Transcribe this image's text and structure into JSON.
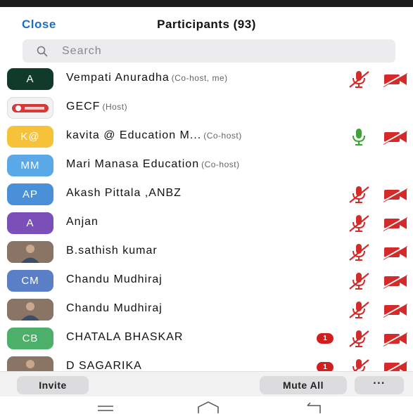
{
  "header": {
    "close_label": "Close",
    "title": "Participants (93)"
  },
  "search": {
    "placeholder": "Search"
  },
  "colors": {
    "accent": "#1f6fbf",
    "muted_red": "#d52a2a",
    "unmuted_green": "#3aa635"
  },
  "participants": [
    {
      "avatar_text": "A",
      "avatar_color": "#103a2a",
      "name": "Vempati Anuradha",
      "role": "(Co-host, me)",
      "mic": "muted",
      "video": "off",
      "badge": ""
    },
    {
      "avatar_text": "",
      "avatar_kind": "logo",
      "name": "GECF",
      "role": "(Host)",
      "mic": "none",
      "video": "none",
      "badge": ""
    },
    {
      "avatar_text": "K@",
      "avatar_color": "#f6c23a",
      "name": "kavita @ Education M...",
      "role": "(Co-host)",
      "mic": "unmuted",
      "video": "off",
      "badge": ""
    },
    {
      "avatar_text": "MM",
      "avatar_color": "#5aa8e6",
      "name": "Mari Manasa Education",
      "role": "(Co-host)",
      "mic": "none",
      "video": "none",
      "badge": ""
    },
    {
      "avatar_text": "AP",
      "avatar_color": "#4a90d9",
      "name": "Akash Pittala ,ANBZ",
      "role": "",
      "mic": "muted",
      "video": "off",
      "badge": ""
    },
    {
      "avatar_text": "A",
      "avatar_color": "#7a4fb8",
      "name": "Anjan",
      "role": "",
      "mic": "muted",
      "video": "off",
      "badge": ""
    },
    {
      "avatar_text": "",
      "avatar_kind": "photo",
      "name": "B.sathish kumar",
      "role": "",
      "mic": "muted",
      "video": "off",
      "badge": ""
    },
    {
      "avatar_text": "CM",
      "avatar_color": "#5b7fc6",
      "name": "Chandu Mudhiraj",
      "role": "",
      "mic": "muted",
      "video": "off",
      "badge": ""
    },
    {
      "avatar_text": "",
      "avatar_kind": "photo",
      "name": "Chandu Mudhiraj",
      "role": "",
      "mic": "muted",
      "video": "off",
      "badge": ""
    },
    {
      "avatar_text": "CB",
      "avatar_color": "#4caf6a",
      "name": "CHATALA BHASKAR",
      "role": "",
      "mic": "muted",
      "video": "off",
      "badge": "1"
    },
    {
      "avatar_text": "",
      "avatar_kind": "photo",
      "name": "D SAGARIKA",
      "role": "",
      "mic": "muted",
      "video": "off",
      "badge": "1"
    }
  ],
  "footer": {
    "invite_label": "Invite",
    "mute_all_label": "Mute All",
    "more_label": "···"
  },
  "icons": {
    "search": "search-icon",
    "mic_muted": "mic-muted-icon",
    "mic_on": "mic-icon",
    "video_off": "video-off-icon"
  }
}
